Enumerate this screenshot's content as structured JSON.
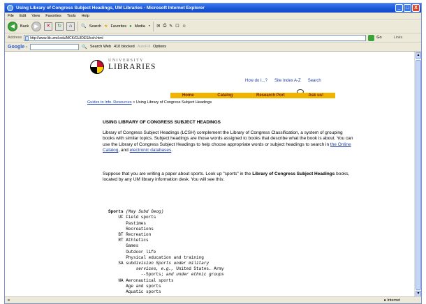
{
  "window": {
    "title": "Using Library of Congress Subject Headings, UM Libraries - Microsoft Internet Explorer",
    "min": "_",
    "max": "□",
    "close": "X"
  },
  "menu": [
    "File",
    "Edit",
    "View",
    "Favorites",
    "Tools",
    "Help"
  ],
  "toolbar": {
    "back": "Back",
    "search": "Search",
    "favorites": "Favorites",
    "media": "Media"
  },
  "address": {
    "label": "Address",
    "url": "http://www.lib.umd.edu/MCK/GUIDES/lcsh.html",
    "go": "Go",
    "links": "Links"
  },
  "google": {
    "logo": "Google -",
    "search_web": "Search Web",
    "blocked": "410 blocked",
    "autofill": "AutoFill",
    "options": "Options"
  },
  "page": {
    "logo_top": "UNIVERSITY",
    "logo_main": "LIBRARIES",
    "top_links": [
      "How do I...?",
      "Site Index A-Z",
      "Search"
    ],
    "nav": [
      "Home",
      "Catalog",
      "Research Port",
      "Ask us!"
    ],
    "crumb_link": "Guides to Info. Resources",
    "crumb_rest": " > Using Library of Congress Subject Headings",
    "heading": "USING LIBRARY OF CONGRESS SUBJECT HEADINGS",
    "p1_a": "Library of Congress Subject Headings (LCSH) complement the Library of Congress Classification, a system of grouping books with similar topics. Subject headings are those words assigned to books that describe what the book is about. You can use the Library of Congress Subject Headings to help choose appropriate words or subject headings to search in ",
    "p1_link1": "the Online Catalog",
    "p1_b": ", and ",
    "p1_link2": "electronic databases",
    "p1_c": ".",
    "p2_a": "Suppose that you are writing a paper about sports. Look up \"sports\" in the ",
    "p2_bold": "Library of Congress Subject Headings",
    "p2_b": " books, located by any UM library information desk. You will see this:",
    "sample": [
      {
        "b": "Sports",
        "i": " (May Subd Geog)"
      },
      {
        "t": "    UF Field sports"
      },
      {
        "t": "       Pastimes"
      },
      {
        "t": "       Recreations"
      },
      {
        "t": "    BT Recreation"
      },
      {
        "t": "    RT Athletics"
      },
      {
        "t": "       Games"
      },
      {
        "t": "       Outdoor life"
      },
      {
        "t": "       Physical education and training"
      },
      {
        "t": "    SA ",
        "i": "subdivision Sports under military"
      },
      {
        "t": "           ",
        "i": "services, e.g.,",
        "t2": " United States. Army"
      },
      {
        "t": "             --Sports; ",
        "i": "and under ethnic groups"
      },
      {
        "t": "    NA Aeronautical sports"
      },
      {
        "t": "       Age and sports"
      },
      {
        "t": "       Aquatic sports"
      }
    ]
  },
  "status": {
    "zone": "Internet"
  },
  "colors": {
    "titlebar": "#1a55d6",
    "nav": "#f0b400",
    "link": "#1d3fa8"
  }
}
